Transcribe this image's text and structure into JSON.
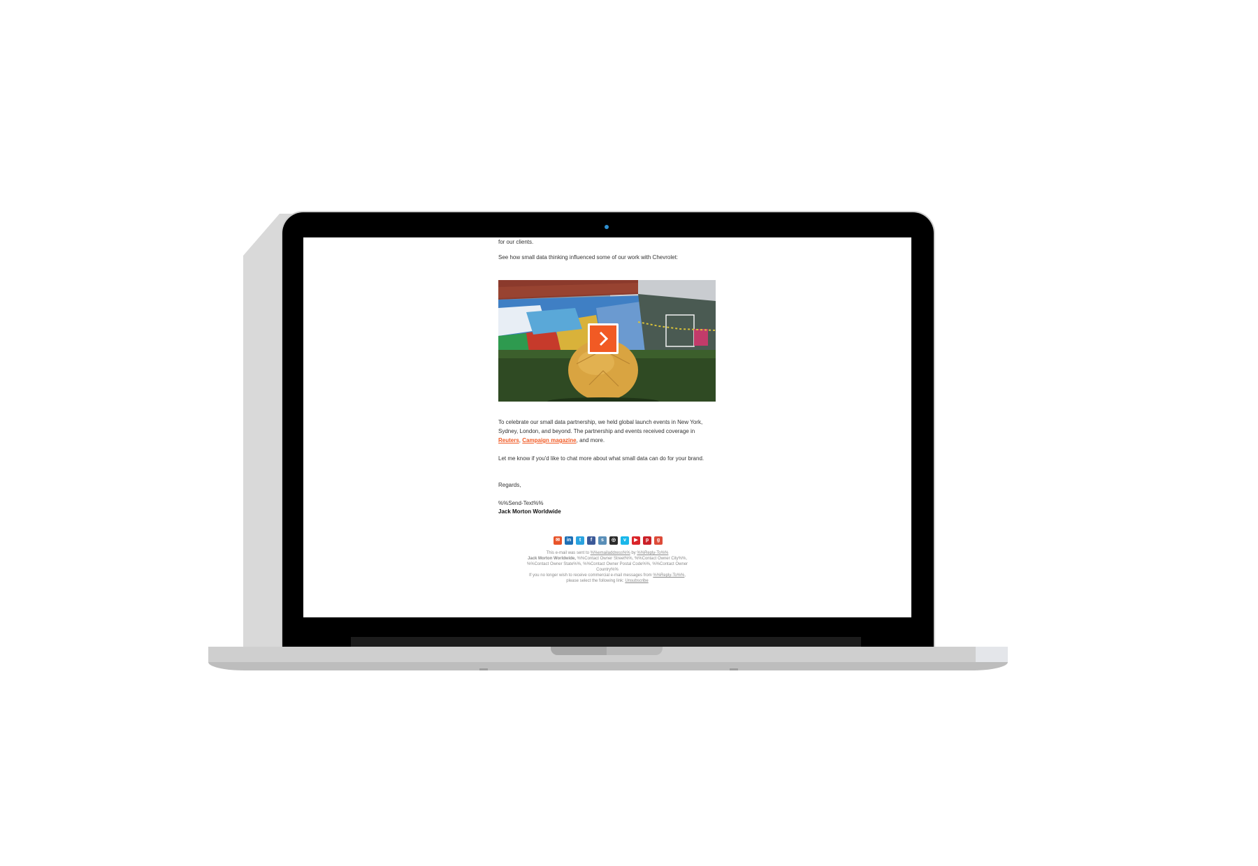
{
  "email": {
    "intro_tail": "for our clients.",
    "see_how": "See how small data thinking influenced some of our work with Chevrolet:",
    "celebrate_text": "To celebrate our small data partnership, we held global launch events in New York, Sydney, London, and beyond. The partnership and events received coverage in",
    "link_reuters": "Reuters",
    "comma": ",",
    "link_campaign": "Campaign magazine",
    "and_more": ", and more.",
    "let_me_know": "Let me know if you'd like to chat more about what small data can do for your brand.",
    "regards": "Regards,",
    "send_text": "%%Send-Text%%",
    "company": "Jack Morton Worldwide"
  },
  "social_icons": [
    {
      "name": "email-icon",
      "glyph": "✉",
      "color": "#e8542a"
    },
    {
      "name": "linkedin-icon",
      "glyph": "in",
      "color": "#1f6fb5"
    },
    {
      "name": "twitter-icon",
      "glyph": "t",
      "color": "#2aa3e0"
    },
    {
      "name": "facebook-icon",
      "glyph": "f",
      "color": "#3b5998"
    },
    {
      "name": "slideshare-icon",
      "glyph": "s",
      "color": "#5a8fb8"
    },
    {
      "name": "instagram-icon",
      "glyph": "◎",
      "color": "#2b2b2b"
    },
    {
      "name": "vimeo-icon",
      "glyph": "v",
      "color": "#1ab7ea"
    },
    {
      "name": "youtube-icon",
      "glyph": "▶",
      "color": "#d9252a"
    },
    {
      "name": "pinterest-icon",
      "glyph": "p",
      "color": "#cb2027"
    },
    {
      "name": "googleplus-icon",
      "glyph": "g",
      "color": "#dd4b39"
    }
  ],
  "footer": {
    "sent_to_prefix": "This e-mail was sent to",
    "sent_to_address": "%%emailaddress%%",
    "by": "by",
    "reply_to": "%%Reply-To%%",
    "company": "Jack Morton Worldwide,",
    "address_line": "%%Contact Owner Street%%, %%Contact Owner City%%, %%Contact Owner State%%, %%Contact Owner Postal Code%%, %%Contact Owner Country%%",
    "unsub_prefix": "If you no longer wish to receive commercial e-mail messages from",
    "unsub_from": "%%Reply-To%%",
    "unsub_suffix": ", please select the following link:",
    "unsubscribe": "Unsubscribe"
  },
  "colors": {
    "accent": "#f15a24",
    "bezel": "#000000",
    "chassis": "#cfcfcf"
  }
}
